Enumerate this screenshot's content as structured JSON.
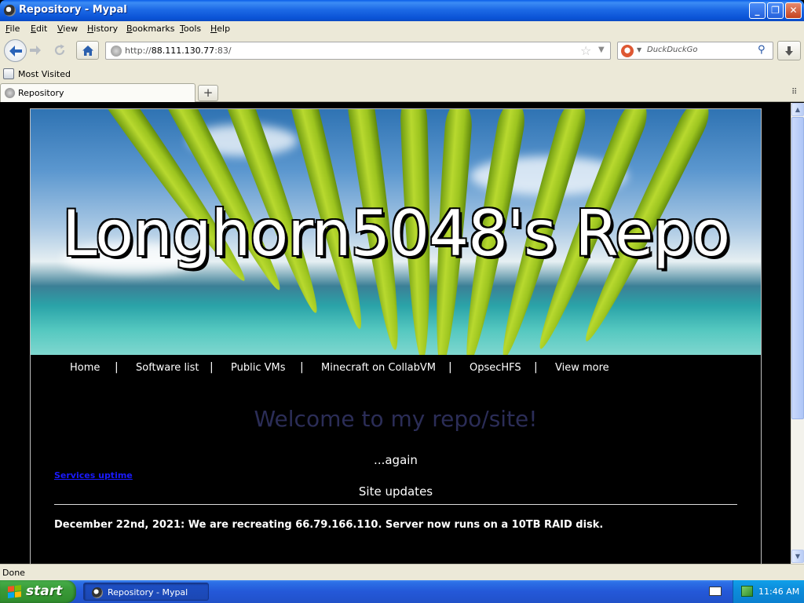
{
  "window": {
    "title": "Repository - Mypal",
    "minimize_glyph": "_",
    "maximize_glyph": "❐",
    "close_glyph": "✕"
  },
  "menu": [
    "File",
    "Edit",
    "View",
    "History",
    "Bookmarks",
    "Tools",
    "Help"
  ],
  "nav": {
    "url_scheme": "http://",
    "url_host": "88.111.130.77",
    "url_rest": ":83/",
    "search_placeholder": "DuckDuckGo",
    "icons": [
      "back-arrow-icon",
      "forward-arrow-icon",
      "reload-icon",
      "home-icon",
      "bookmark-star-icon",
      "search-icon",
      "download-icon"
    ]
  },
  "bookmarks": {
    "most_visited": "Most Visited"
  },
  "tabs": [
    {
      "label": "Repository"
    }
  ],
  "newtab_glyph": "+",
  "site": {
    "title": "Longhorn5048's Repo",
    "nav": [
      "Home",
      "Software list",
      "Public VMs",
      "Minecraft on CollabVM",
      "OpsecHFS",
      "View more"
    ],
    "nav_separator": "|",
    "welcome": "Welcome to my repo/site!",
    "again": "...again",
    "uptime_link": "Services uptime",
    "updates_heading": "Site updates",
    "updates": [
      "December 22nd, 2021: We are recreating 66.79.166.110. Server now runs on a 10TB RAID disk."
    ]
  },
  "status": {
    "text": "Done"
  },
  "taskbar": {
    "start_label": "start",
    "task_label": "Repository - Mypal",
    "clock": "11:46 AM"
  },
  "colors": {
    "welcome_text": "#2b2d57",
    "link": "#1a1aff",
    "titlebar_blue": "#1d6ae6",
    "start_green": "#3a9a38"
  }
}
